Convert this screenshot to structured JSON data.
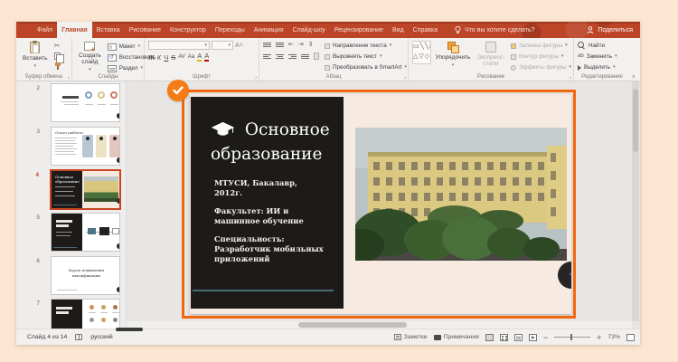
{
  "titlebar": {
    "tabs": [
      {
        "label": "Файл"
      },
      {
        "label": "Главная"
      },
      {
        "label": "Вставка"
      },
      {
        "label": "Рисование"
      },
      {
        "label": "Конструктор"
      },
      {
        "label": "Переходы"
      },
      {
        "label": "Анимация"
      },
      {
        "label": "Слайд-шоу"
      },
      {
        "label": "Рецензирование"
      },
      {
        "label": "Вид"
      },
      {
        "label": "Справка"
      }
    ],
    "tell_me": "Что вы хотите сделать?",
    "share_label": "Поделиться"
  },
  "ribbon": {
    "paste_label": "Вставить",
    "group_clipboard": "Буфер обмена",
    "new_slide_label": "Создать слайд",
    "layout_label": "Макет",
    "reset_label": "Восстановить",
    "section_label": "Раздел",
    "group_slides": "Слайды",
    "bold_label": "Ж",
    "italic_label": "К",
    "underline_label": "Ч",
    "strike_label": "S",
    "spacing_label": "AV",
    "case_label": "Аа",
    "color_label": "А",
    "group_font": "Шрифт",
    "text_direction_label": "Направление текста",
    "align_text_label": "Выровнять текст",
    "smartart_label": "Преобразовать в SmartArt",
    "group_paragraph": "Абзац",
    "shapes_row1": "▭╲╲□○▭",
    "shapes_row2": "△▽◇○☆╲",
    "arrange_label": "Упорядочить",
    "quick_styles_label": "Экспресс-стили",
    "shape_fill_label": "Заливка фигуры",
    "shape_outline_label": "Контур фигуры",
    "shape_effects_label": "Эффекты фигуры",
    "group_drawing": "Рисование",
    "find_label": "Найти",
    "replace_label": "Заменить",
    "select_label": "Выделить",
    "group_editing": "Редактирование"
  },
  "thumbnails": {
    "items": [
      {
        "num": "2"
      },
      {
        "num": "3",
        "title": "Опыт работы"
      },
      {
        "num": "4",
        "selected": true
      },
      {
        "num": "5"
      },
      {
        "num": "6",
        "caption": "Курсы повышения квалификации"
      },
      {
        "num": "7"
      }
    ]
  },
  "slide": {
    "icon": "graduation-cap",
    "title_line1": "Основное",
    "title_line2": "образование",
    "paragraphs": [
      "МТУСИ, Бакалавр, 2012г.",
      "Факультет: ИИ и машинное обучение",
      "Специальность: Разработчик мобильных приложений"
    ]
  },
  "statusbar": {
    "slide_counter": "Слайд 4 из 14",
    "language": "русский",
    "notes_label": "Заметки",
    "comments_label": "Примечания",
    "zoom_value": "73%"
  },
  "colors": {
    "accent_red": "#bc4528",
    "annotation_orange": "#f2670e",
    "slide_dark": "#1d1b1a",
    "teal_line": "#4b6b74",
    "background_peach": "#fce5d1"
  }
}
